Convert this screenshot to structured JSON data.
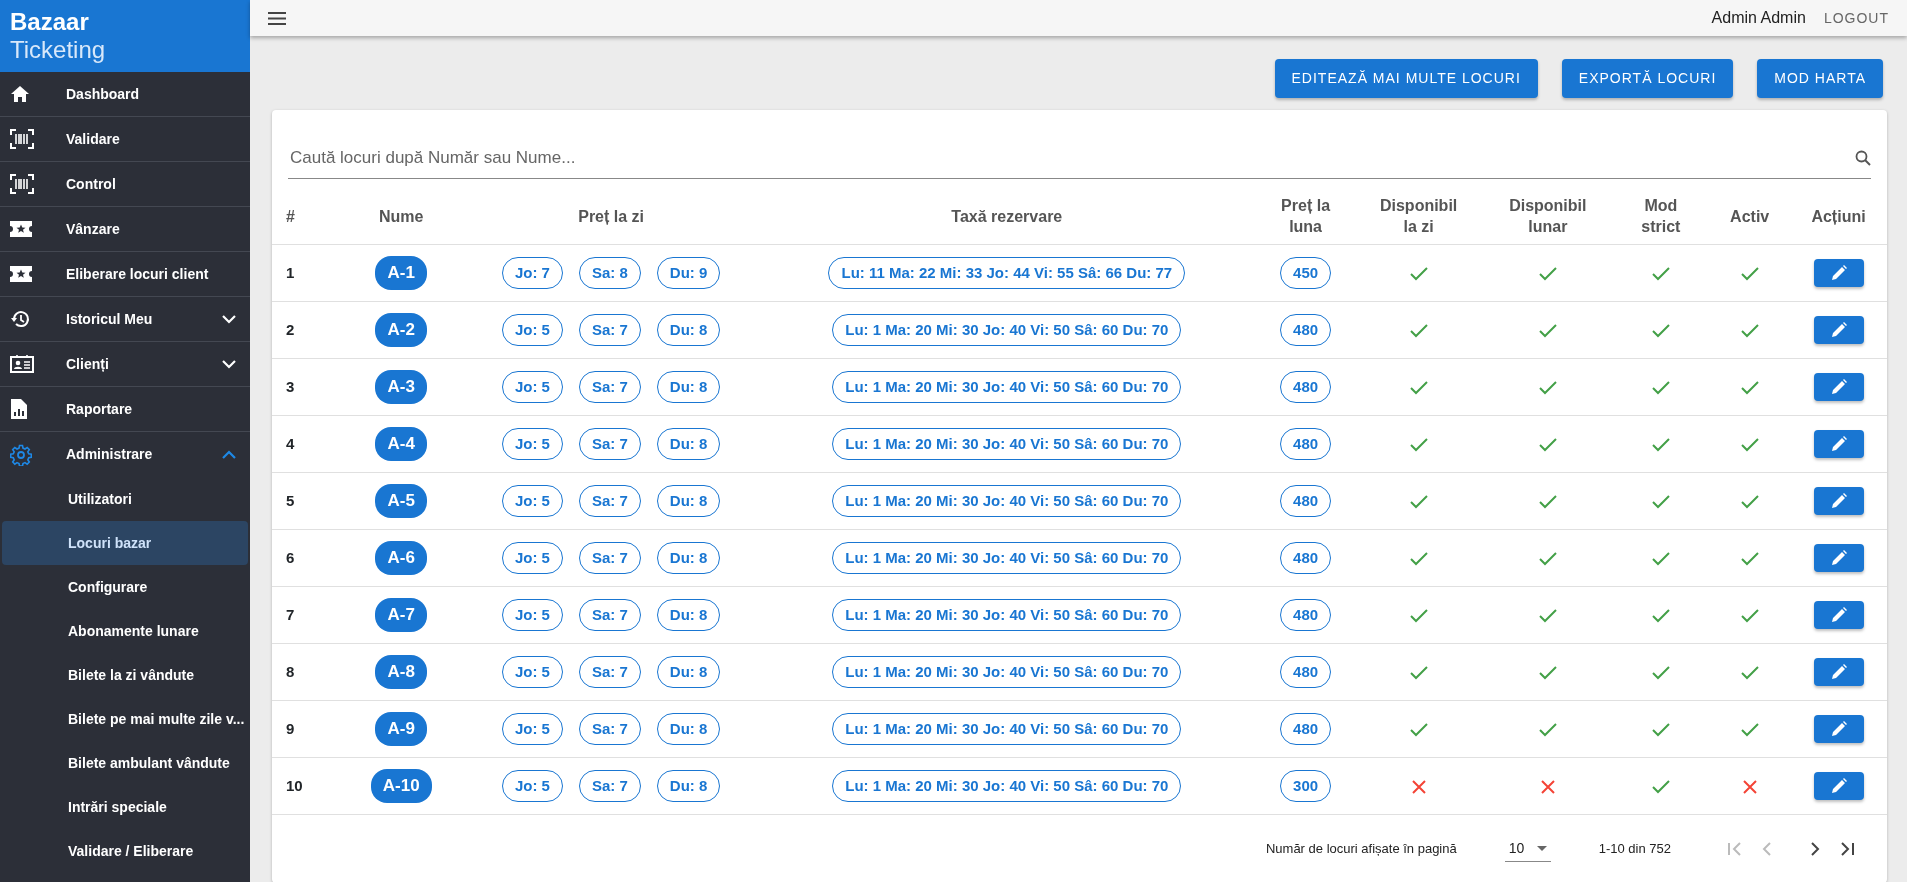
{
  "sidebar": {
    "brand": {
      "title": "Bazaar",
      "subtitle": "Ticketing"
    },
    "items": [
      {
        "label": "Dashboard",
        "selected": false
      },
      {
        "label": "Validare",
        "selected": false
      },
      {
        "label": "Control",
        "selected": false
      },
      {
        "label": "Vânzare",
        "selected": false
      },
      {
        "label": "Eliberare locuri client",
        "selected": false
      },
      {
        "label": "Istoricul Meu",
        "selected": false,
        "expanded": false
      },
      {
        "label": "Clienți",
        "selected": false,
        "expanded": false
      },
      {
        "label": "Raportare",
        "selected": false
      },
      {
        "label": "Administrare",
        "selected": true,
        "expanded": true,
        "children": [
          {
            "label": "Utilizatori",
            "selected": false
          },
          {
            "label": "Locuri bazar",
            "selected": true
          },
          {
            "label": "Configurare",
            "selected": false
          },
          {
            "label": "Abonamente lunare",
            "selected": false
          },
          {
            "label": "Bilete la zi vândute",
            "selected": false
          },
          {
            "label": "Bilete pe mai multe zile v...",
            "selected": false
          },
          {
            "label": "Bilete ambulant vândute",
            "selected": false
          },
          {
            "label": "Intrări speciale",
            "selected": false
          },
          {
            "label": "Validare / Eliberare",
            "selected": false
          }
        ]
      }
    ]
  },
  "topbar": {
    "user": "Admin Admin",
    "logout": "LOGOUT"
  },
  "toolbar": {
    "buttons": [
      "EDITEAZĂ MAI MULTE LOCURI",
      "EXPORTĂ LOCURI",
      "MOD HARTA"
    ]
  },
  "search": {
    "placeholder": "Caută locuri după Număr sau Nume..."
  },
  "table": {
    "columns": [
      "#",
      "Nume",
      "Preț la zi",
      "Taxă rezervare",
      "Preț la luna",
      "Disponibil la zi",
      "Disponibil lunar",
      "Mod strict",
      "Activ",
      "Acțiuni"
    ],
    "rows": [
      {
        "number": "1",
        "name": "A-1",
        "day_prices": [
          "Jo: 7",
          "Sa: 8",
          "Du: 9"
        ],
        "reservation_fee": "Lu: 11 Ma: 22 Mi: 33 Jo: 44 Vi: 55 Sâ: 66 Du: 77",
        "monthly_price": "450",
        "available_daily": true,
        "available_monthly": true,
        "strict_mode": true,
        "active": true
      },
      {
        "number": "2",
        "name": "A-2",
        "day_prices": [
          "Jo: 5",
          "Sa: 7",
          "Du: 8"
        ],
        "reservation_fee": "Lu: 1 Ma: 20 Mi: 30 Jo: 40 Vi: 50 Sâ: 60 Du: 70",
        "monthly_price": "480",
        "available_daily": true,
        "available_monthly": true,
        "strict_mode": true,
        "active": true
      },
      {
        "number": "3",
        "name": "A-3",
        "day_prices": [
          "Jo: 5",
          "Sa: 7",
          "Du: 8"
        ],
        "reservation_fee": "Lu: 1 Ma: 20 Mi: 30 Jo: 40 Vi: 50 Sâ: 60 Du: 70",
        "monthly_price": "480",
        "available_daily": true,
        "available_monthly": true,
        "strict_mode": true,
        "active": true
      },
      {
        "number": "4",
        "name": "A-4",
        "day_prices": [
          "Jo: 5",
          "Sa: 7",
          "Du: 8"
        ],
        "reservation_fee": "Lu: 1 Ma: 20 Mi: 30 Jo: 40 Vi: 50 Sâ: 60 Du: 70",
        "monthly_price": "480",
        "available_daily": true,
        "available_monthly": true,
        "strict_mode": true,
        "active": true
      },
      {
        "number": "5",
        "name": "A-5",
        "day_prices": [
          "Jo: 5",
          "Sa: 7",
          "Du: 8"
        ],
        "reservation_fee": "Lu: 1 Ma: 20 Mi: 30 Jo: 40 Vi: 50 Sâ: 60 Du: 70",
        "monthly_price": "480",
        "available_daily": true,
        "available_monthly": true,
        "strict_mode": true,
        "active": true
      },
      {
        "number": "6",
        "name": "A-6",
        "day_prices": [
          "Jo: 5",
          "Sa: 7",
          "Du: 8"
        ],
        "reservation_fee": "Lu: 1 Ma: 20 Mi: 30 Jo: 40 Vi: 50 Sâ: 60 Du: 70",
        "monthly_price": "480",
        "available_daily": true,
        "available_monthly": true,
        "strict_mode": true,
        "active": true
      },
      {
        "number": "7",
        "name": "A-7",
        "day_prices": [
          "Jo: 5",
          "Sa: 7",
          "Du: 8"
        ],
        "reservation_fee": "Lu: 1 Ma: 20 Mi: 30 Jo: 40 Vi: 50 Sâ: 60 Du: 70",
        "monthly_price": "480",
        "available_daily": true,
        "available_monthly": true,
        "strict_mode": true,
        "active": true
      },
      {
        "number": "8",
        "name": "A-8",
        "day_prices": [
          "Jo: 5",
          "Sa: 7",
          "Du: 8"
        ],
        "reservation_fee": "Lu: 1 Ma: 20 Mi: 30 Jo: 40 Vi: 50 Sâ: 60 Du: 70",
        "monthly_price": "480",
        "available_daily": true,
        "available_monthly": true,
        "strict_mode": true,
        "active": true
      },
      {
        "number": "9",
        "name": "A-9",
        "day_prices": [
          "Jo: 5",
          "Sa: 7",
          "Du: 8"
        ],
        "reservation_fee": "Lu: 1 Ma: 20 Mi: 30 Jo: 40 Vi: 50 Sâ: 60 Du: 70",
        "monthly_price": "480",
        "available_daily": true,
        "available_monthly": true,
        "strict_mode": true,
        "active": true
      },
      {
        "number": "10",
        "name": "A-10",
        "day_prices": [
          "Jo: 5",
          "Sa: 7",
          "Du: 8"
        ],
        "reservation_fee": "Lu: 1 Ma: 20 Mi: 30 Jo: 40 Vi: 50 Sâ: 60 Du: 70",
        "monthly_price": "300",
        "available_daily": false,
        "available_monthly": false,
        "strict_mode": true,
        "active": false
      }
    ]
  },
  "pagination": {
    "rows_label": "Număr de locuri afișate în pagină",
    "rows_per_page": "10",
    "range": "1-10 din 752",
    "buttons": [
      {
        "kind": "first",
        "disabled": true
      },
      {
        "kind": "previous",
        "disabled": true
      },
      {
        "kind": "next",
        "disabled": false
      },
      {
        "kind": "last",
        "disabled": false
      }
    ]
  }
}
